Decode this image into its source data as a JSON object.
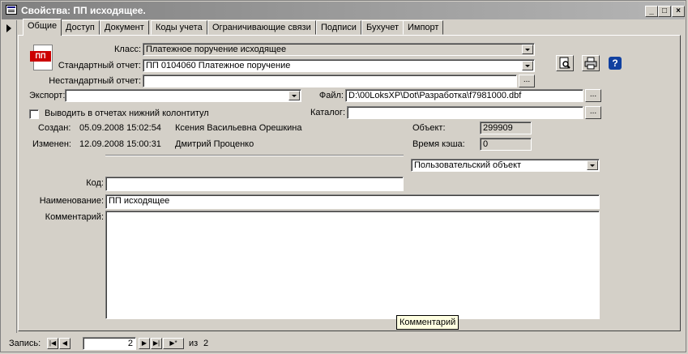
{
  "window": {
    "title": "Свойства: ПП исходящее."
  },
  "tabs": [
    "Общие",
    "Доступ",
    "Документ",
    "Коды учета",
    "Ограничивающие связи",
    "Подписи",
    "Бухучет",
    "Импорт"
  ],
  "form_icon": {
    "text": "ПП",
    "color": "#cc0000"
  },
  "fields": {
    "klass_label": "Класс:",
    "klass_value": "Платежное поручение исходящее",
    "standard_label": "Стандартный отчет:",
    "standard_value": "ПП 0104060 Платежное поручение",
    "nonstandard_label": "Нестандартный отчет:",
    "nonstandard_value": "",
    "export_label": "Экспорт:",
    "export_value": "",
    "file_label": "Файл:",
    "file_value": "D:\\00LoksXP\\Dot\\Разработка\\f7981000.dbf",
    "catalog_label": "Каталог:",
    "catalog_value": "",
    "footer_check_label": "Выводить в отчетах нижний колонтитул",
    "created_label": "Создан:",
    "created_date": "05.09.2008 15:02:54",
    "created_user": "Ксения Васильевна Орешкина",
    "modified_label": "Изменен:",
    "modified_date": "12.09.2008 15:00:31",
    "modified_user": "Дмитрий Проценко",
    "object_label": "Объект:",
    "object_value": "299909",
    "cache_label": "Время кэша:",
    "cache_value": "0",
    "object_type_value": "Пользовательский объект",
    "code_label": "Код:",
    "code_value": "",
    "name_label": "Наименование:",
    "name_value": "ПП исходящее",
    "comment_label": "Комментарий:",
    "comment_value": ""
  },
  "buttons": {
    "ellipsis": "..."
  },
  "tooltip": "Комментарий",
  "record_nav": {
    "label": "Запись:",
    "current": "2",
    "of_label": "из",
    "total": "2"
  }
}
